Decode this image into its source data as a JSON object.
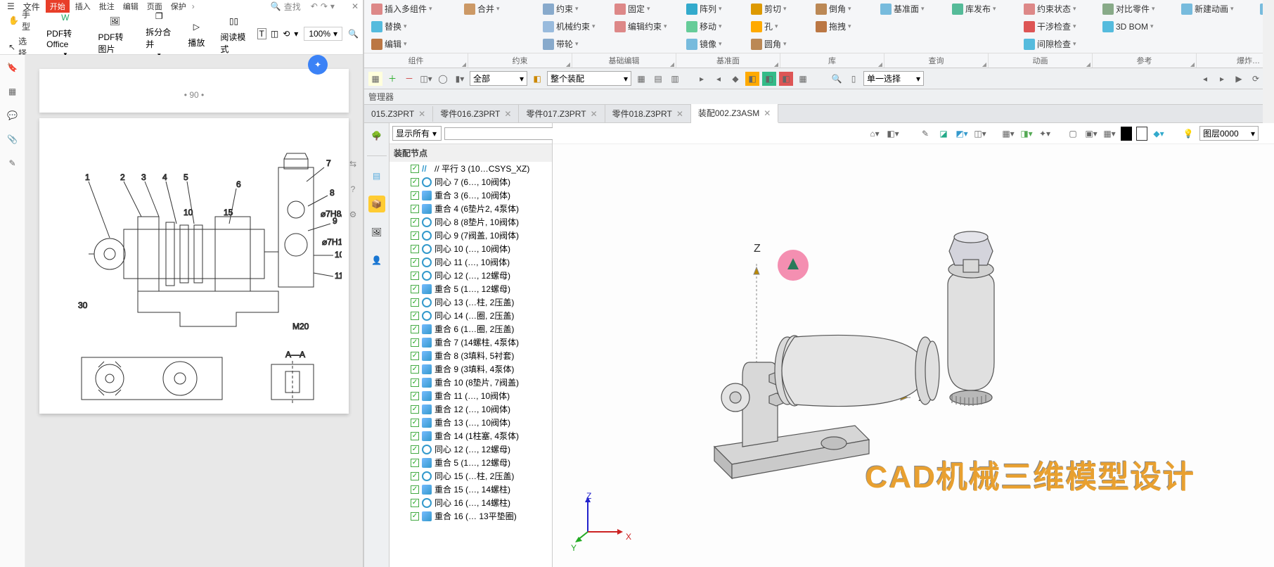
{
  "pdf": {
    "menu_label": "文件",
    "tabs": {
      "active": "开始",
      "items": [
        "插入",
        "批注",
        "编辑",
        "页面",
        "保护"
      ]
    },
    "search_placeholder": "查找",
    "tools": {
      "hand": "手型",
      "select": "选择",
      "pdf_office": "PDF转Office",
      "pdf_img": "PDF转图片",
      "split": "拆分合并",
      "play": "播放",
      "read": "阅读模式",
      "zoom": "100%"
    },
    "page_number": "• 90 •"
  },
  "ribbon": {
    "row1": [
      {
        "icon": "#d88",
        "label": "插入多组件"
      },
      {
        "icon": "#c96",
        "label": "合并"
      },
      {
        "icon": "#8ac",
        "label": "约束"
      },
      {
        "icon": "#d88",
        "label": "固定"
      },
      {
        "icon": "#3ac",
        "label": "阵列"
      },
      {
        "icon": "#d90",
        "label": "剪切"
      },
      {
        "icon": "#b85",
        "label": "倒角"
      },
      {
        "icon": "#7bd",
        "label": "基准面"
      },
      {
        "icon": "#5b9",
        "label": "库发布"
      },
      {
        "icon": "#d88",
        "label": "约束状态"
      },
      {
        "icon": "#8a8",
        "label": "对比零件"
      },
      {
        "icon": "#7bd",
        "label": "新建动画"
      },
      {
        "icon": "#7bd",
        "label": ""
      }
    ],
    "row2": [
      {
        "icon": "#5bd",
        "label": "替换"
      },
      {
        "icon": "",
        "label": ""
      },
      {
        "icon": "#9bd",
        "label": "机械约束"
      },
      {
        "icon": "#d88",
        "label": "编辑约束"
      },
      {
        "icon": "#6c9",
        "label": "移动"
      },
      {
        "icon": "#fa0",
        "label": "孔"
      },
      {
        "icon": "#b74",
        "label": "拖拽"
      },
      {
        "icon": "",
        "label": ""
      },
      {
        "icon": "",
        "label": ""
      },
      {
        "icon": "#d55",
        "label": "干涉检查"
      },
      {
        "icon": "#5bd",
        "label": "3D BOM"
      },
      {
        "icon": "",
        "label": ""
      },
      {
        "icon": "",
        "label": ""
      }
    ],
    "row3": [
      {
        "icon": "#b74",
        "label": "编辑"
      },
      {
        "icon": "",
        "label": ""
      },
      {
        "icon": "#8ac",
        "label": "带轮"
      },
      {
        "icon": "",
        "label": ""
      },
      {
        "icon": "#7bd",
        "label": "镜像"
      },
      {
        "icon": "#b85",
        "label": "圆角"
      },
      {
        "icon": "",
        "label": ""
      },
      {
        "icon": "",
        "label": ""
      },
      {
        "icon": "",
        "label": ""
      },
      {
        "icon": "#5bd",
        "label": "间隙检查"
      },
      {
        "icon": "",
        "label": ""
      },
      {
        "icon": "",
        "label": ""
      },
      {
        "icon": "",
        "label": ""
      }
    ],
    "groups": [
      "组件",
      "约束",
      "基础编辑",
      "基准面",
      "库",
      "查询",
      "动画",
      "参考",
      "爆炸…"
    ]
  },
  "toolbar2": {
    "filter_all": "全部",
    "assembly_scope": "整个装配",
    "select_mode": "单一选择",
    "layer": "图层0000"
  },
  "manager_title": "管理器",
  "tree": {
    "show_all": "显示所有",
    "root": "装配节点",
    "items": [
      {
        "t": "par",
        "label": "// 平行 3 (10…CSYS_XZ)"
      },
      {
        "t": "cir",
        "label": "同心 7 (6…, 10阀体)"
      },
      {
        "t": "coin",
        "label": "重合 3 (6…, 10阀体)"
      },
      {
        "t": "coin",
        "label": "重合 4 (6垫片2, 4泵体)"
      },
      {
        "t": "cir",
        "label": "同心 8 (8垫片, 10阀体)"
      },
      {
        "t": "cir",
        "label": "同心 9 (7阀盖, 10阀体)"
      },
      {
        "t": "cir",
        "label": "同心 10 (…, 10阀体)"
      },
      {
        "t": "cir",
        "label": "同心 11 (…, 10阀体)"
      },
      {
        "t": "cir",
        "label": "同心 12 (…, 12螺母)"
      },
      {
        "t": "coin",
        "label": "重合 5 (1…, 12螺母)"
      },
      {
        "t": "cir",
        "label": "同心 13 (…柱, 2压盖)"
      },
      {
        "t": "cir",
        "label": "同心 14 (…圈, 2压盖)"
      },
      {
        "t": "coin",
        "label": "重合 6 (1…圈, 2压盖)"
      },
      {
        "t": "coin",
        "label": "重合 7 (14螺柱, 4泵体)"
      },
      {
        "t": "coin",
        "label": "重合 8 (3填料, 5衬套)"
      },
      {
        "t": "coin",
        "label": "重合 9 (3填料, 4泵体)"
      },
      {
        "t": "coin",
        "label": "重合 10 (8垫片, 7阀盖)"
      },
      {
        "t": "coin",
        "label": "重合 11 (…, 10阀体)"
      },
      {
        "t": "coin",
        "label": "重合 12 (…, 10阀体)"
      },
      {
        "t": "coin",
        "label": "重合 13 (…, 10阀体)"
      },
      {
        "t": "coin",
        "label": "重合 14 (1柱塞, 4泵体)"
      },
      {
        "t": "cir",
        "label": "同心 12 (…, 12螺母)"
      },
      {
        "t": "coin",
        "label": "重合 5 (1…, 12螺母)"
      },
      {
        "t": "cir",
        "label": "同心 15 (…柱, 2压盖)"
      },
      {
        "t": "coin",
        "label": "重合 15 (…, 14螺柱)"
      },
      {
        "t": "cir",
        "label": "同心 16 (…, 14螺柱)"
      },
      {
        "t": "coin",
        "label": "重合 16 (… 13平垫圈)"
      }
    ]
  },
  "file_tabs": [
    {
      "name": "015.Z3PRT",
      "active": false
    },
    {
      "name": "零件016.Z3PRT",
      "active": false
    },
    {
      "name": "零件017.Z3PRT",
      "active": false
    },
    {
      "name": "零件018.Z3PRT",
      "active": false
    },
    {
      "name": "装配002.Z3ASM",
      "active": true
    }
  ],
  "axes": {
    "z": "Z",
    "x": "X"
  },
  "corner_axes": {
    "z": "Z",
    "x": "X",
    "y": "Y"
  },
  "watermark": "CAD机械三维模型设计"
}
